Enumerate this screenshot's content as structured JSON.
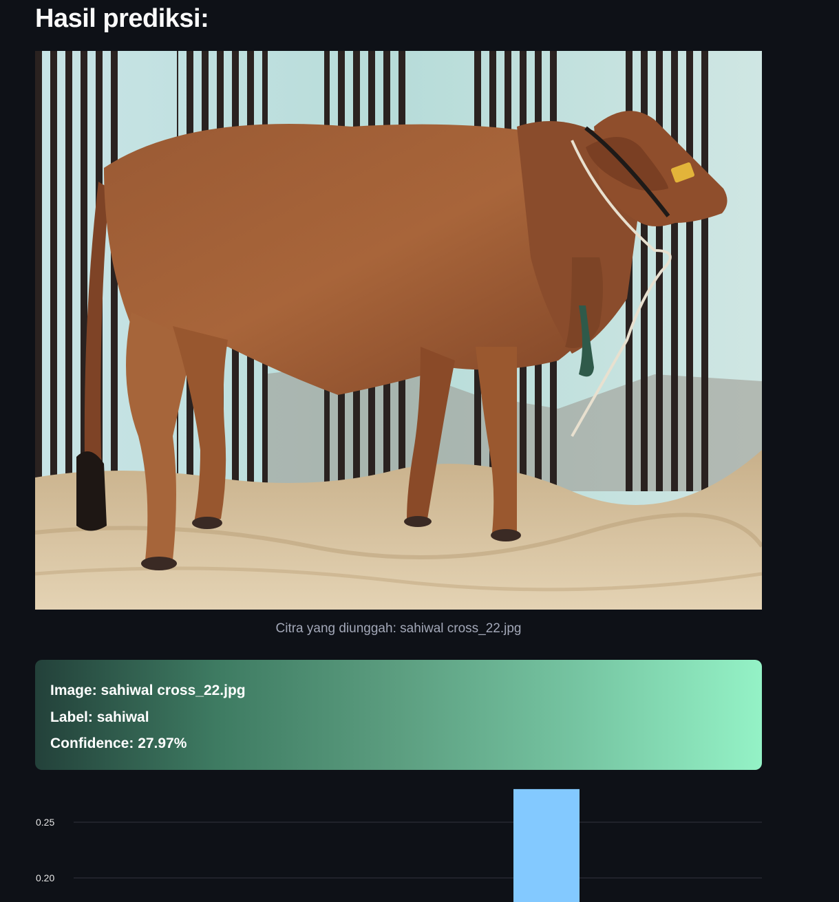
{
  "page": {
    "title": "Hasil prediksi:"
  },
  "image": {
    "caption": "Citra yang diunggah: sahiwal cross_22.jpg"
  },
  "result": {
    "image_label": "Image:",
    "image_value": "sahiwal cross_22.jpg",
    "label_label": "Label:",
    "label_value": "sahiwal",
    "confidence_label": "Confidence:",
    "confidence_value": "27.97%"
  },
  "colors": {
    "background": "#0e1117",
    "bar": "#83c9ff",
    "gradient_start": "#23413a",
    "gradient_end": "#94f2c6"
  },
  "chart_data": {
    "type": "bar",
    "ytick_labels": [
      "0.25",
      "0.20"
    ],
    "yticks": [
      0.25,
      0.2
    ],
    "values": [
      0.2797
    ],
    "grid": true
  }
}
